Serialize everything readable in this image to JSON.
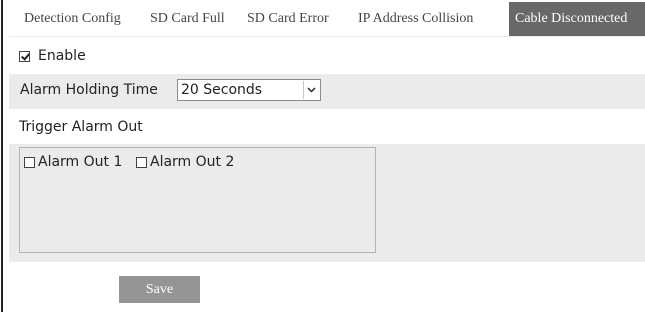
{
  "tabs": [
    {
      "label": "Detection Config",
      "active": false
    },
    {
      "label": "SD Card Full",
      "active": false
    },
    {
      "label": "SD Card Error",
      "active": false
    },
    {
      "label": "IP Address Collision",
      "active": false
    },
    {
      "label": "Cable Disconnected",
      "active": true
    }
  ],
  "enable": {
    "label": "Enable",
    "checked": true
  },
  "alarm_holding_time": {
    "label": "Alarm Holding Time",
    "value": "20 Seconds",
    "icon": "chevron-down-icon"
  },
  "trigger_alarm_out": {
    "label": "Trigger Alarm Out",
    "outputs": [
      {
        "label": "Alarm Out 1",
        "checked": false
      },
      {
        "label": "Alarm Out 2",
        "checked": false
      }
    ]
  },
  "save_label": "Save",
  "colors": {
    "active_tab": "#686868",
    "panel": "#ebebeb",
    "save_button": "#959595"
  }
}
